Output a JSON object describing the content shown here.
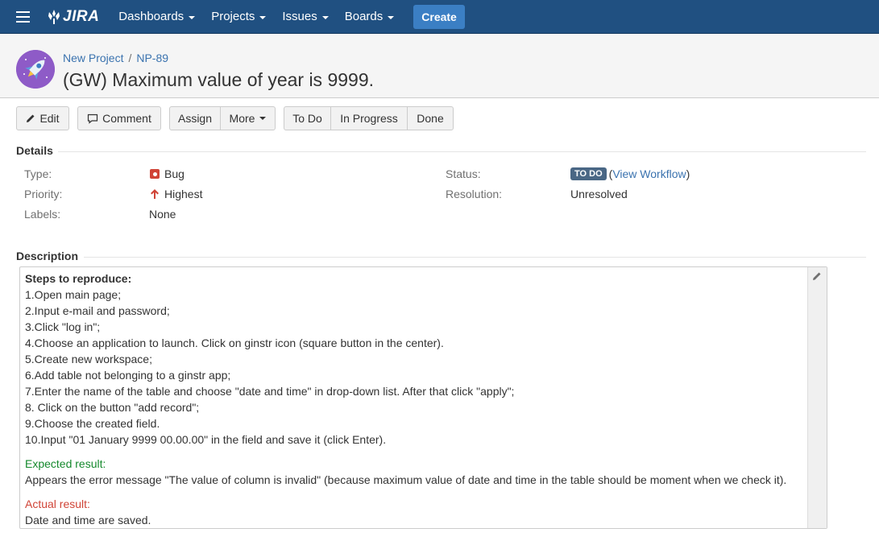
{
  "nav": {
    "logo_text": "JIRA",
    "items": [
      "Dashboards",
      "Projects",
      "Issues",
      "Boards"
    ],
    "create_label": "Create",
    "bg_color": "#205081"
  },
  "header": {
    "project_name": "New Project",
    "issue_key": "NP-89",
    "separator": "/",
    "title": "(GW) Maximum value of year is 9999."
  },
  "toolbar": {
    "edit": "Edit",
    "comment": "Comment",
    "assign": "Assign",
    "more": "More",
    "todo": "To Do",
    "in_progress": "In Progress",
    "done": "Done"
  },
  "details": {
    "heading": "Details",
    "type_label": "Type:",
    "type_value": "Bug",
    "priority_label": "Priority:",
    "priority_value": "Highest",
    "labels_label": "Labels:",
    "labels_value": "None",
    "status_label": "Status:",
    "status_value": "TO DO",
    "view_workflow": "View Workflow",
    "resolution_label": "Resolution:",
    "resolution_value": "Unresolved"
  },
  "description": {
    "heading": "Description",
    "steps_heading": "Steps to reproduce:",
    "steps": [
      "1.Open main page;",
      "2.Input e-mail and password;",
      "3.Click \"log in\";",
      "4.Choose an application to launch. Click on ginstr icon (square button in the center).",
      "5.Create new workspace;",
      "6.Add table not belonging to a ginstr app;",
      "7.Enter the name of the table and choose \"date and time\" in drop-down list. After that click \"apply\";",
      "8. Click on the button \"add record\";",
      "9.Choose the created field.",
      "10.Input \"01 January 9999 00.00.00\" in the field and save it (click Enter)."
    ],
    "expected_label": "Expected result:",
    "expected_text": "Appears the error message \"The value of column is invalid\" (because maximum value of date and time in the table should be moment when we check it).",
    "actual_label": "Actual result:",
    "actual_text": "Date and time are saved."
  }
}
